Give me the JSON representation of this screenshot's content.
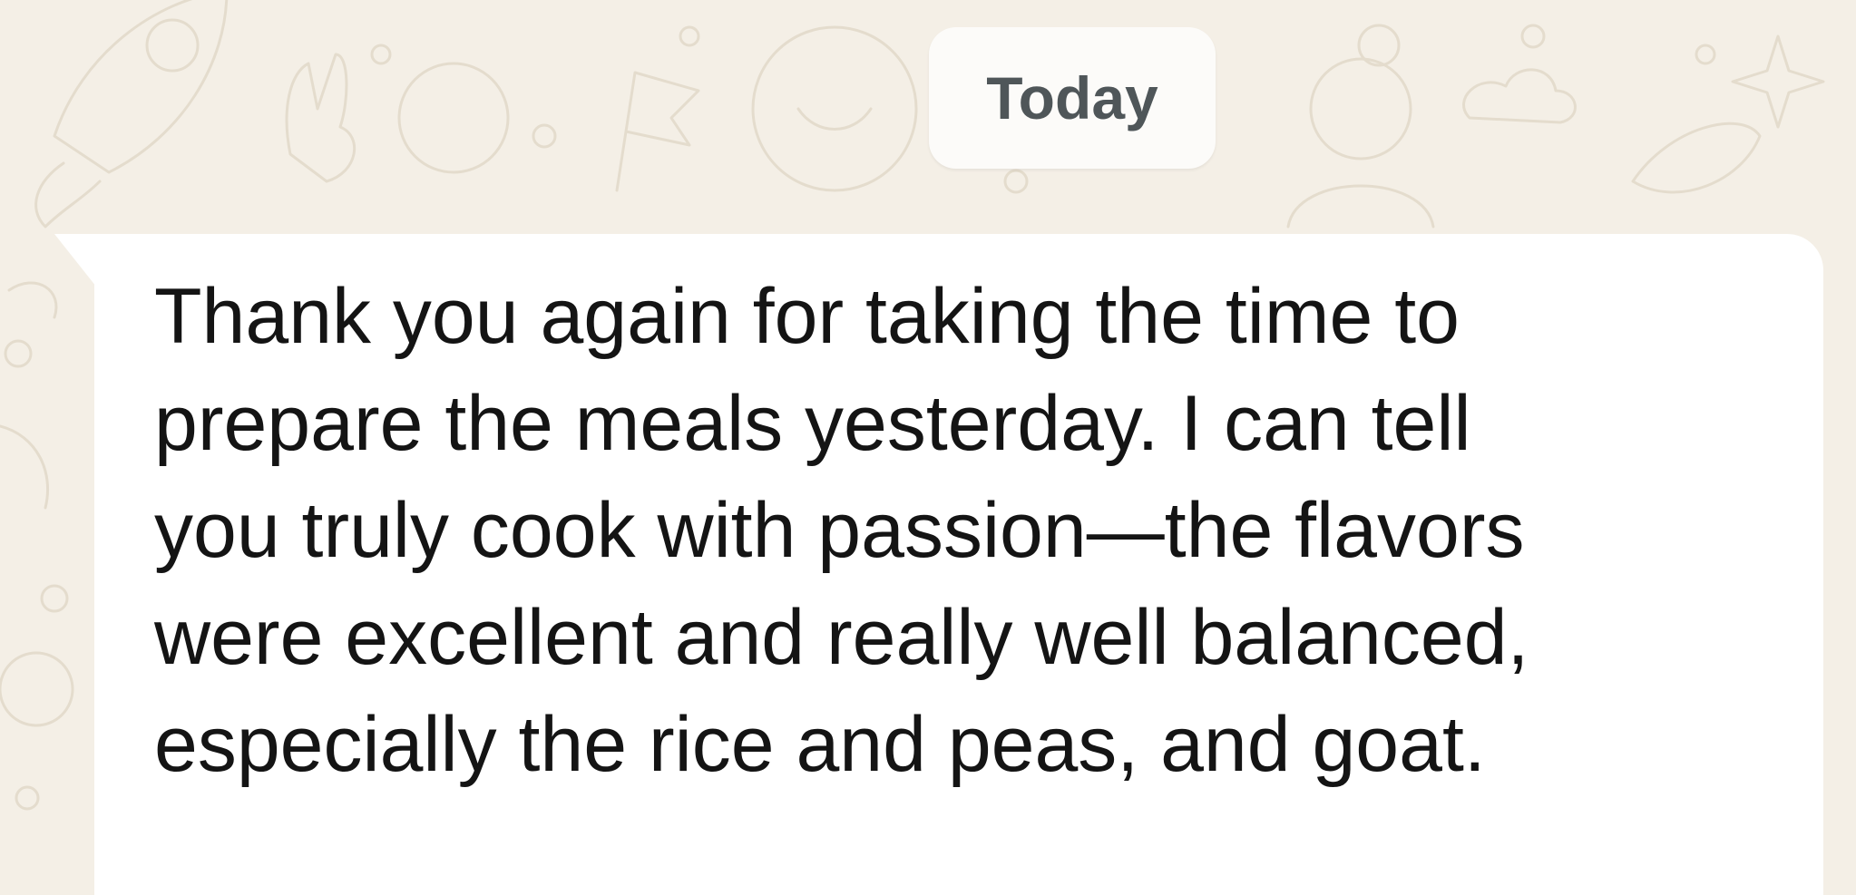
{
  "chat": {
    "date_divider": "Today",
    "message": {
      "lines": [
        "Thank you again for taking the time to",
        "prepare the meals yesterday. I can tell",
        "you truly cook with passion—the flavors",
        "were excellent and really well balanced,",
        "especially the rice and peas, and goat."
      ]
    }
  },
  "colors": {
    "wallpaper": "#f4efe6",
    "doodle_stroke": "#e4dccd",
    "bubble": "#ffffff",
    "chip_background": "#fcfbf9",
    "chip_text": "#4f5659",
    "message_text": "#141414"
  },
  "icons": {
    "wallpaper": "chat-doodle-pattern"
  }
}
